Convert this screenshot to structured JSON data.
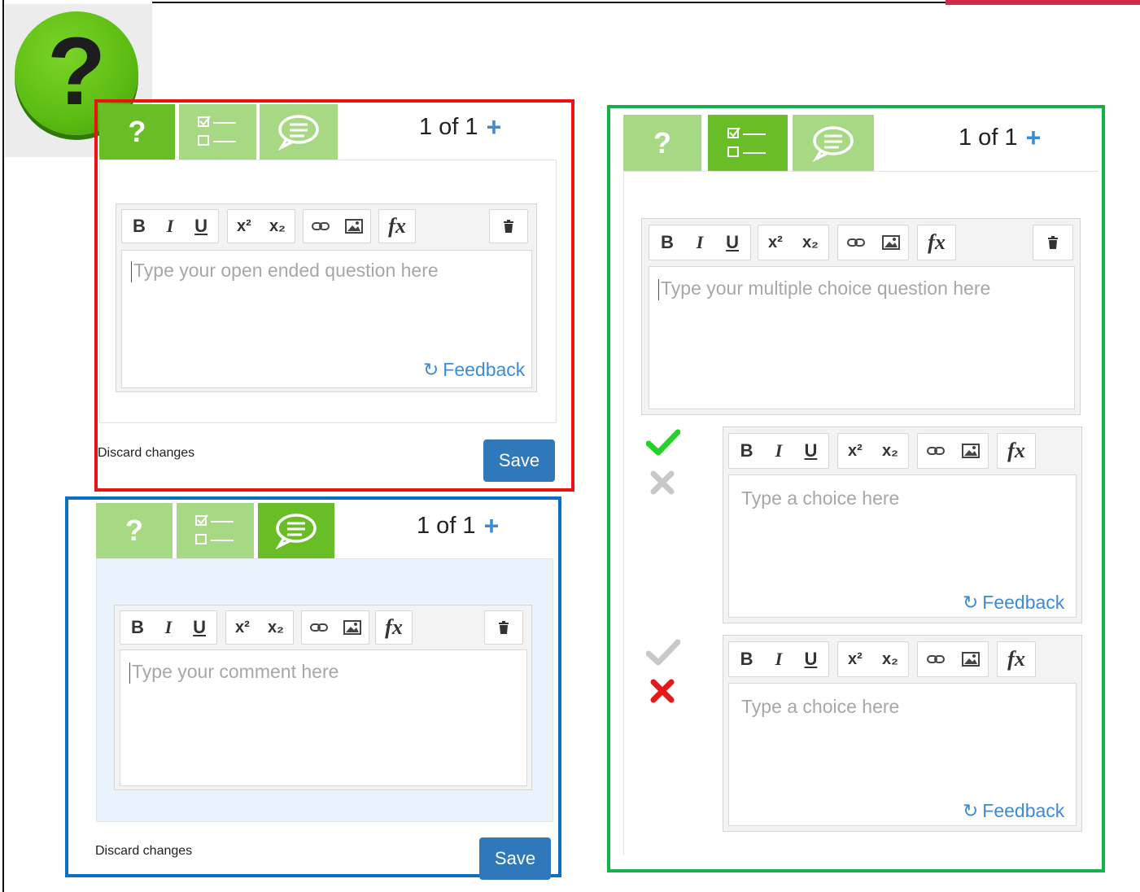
{
  "toolbar": {
    "bold": "B",
    "italic": "I",
    "underline": "U",
    "superscript": "x²",
    "subscript": "x₂",
    "formula": "fx"
  },
  "open_ended": {
    "counter": "1 of 1",
    "add": "+",
    "placeholder": "Type your open ended question here",
    "feedback": "Feedback",
    "discard": "Discard changes",
    "save": "Save"
  },
  "comment": {
    "counter": "1 of 1",
    "add": "+",
    "placeholder": "Type your comment here",
    "discard": "Discard changes",
    "save": "Save"
  },
  "multiple_choice": {
    "counter": "1 of 1",
    "add": "+",
    "placeholder": "Type your multiple choice question here",
    "choices": [
      {
        "placeholder": "Type a choice here",
        "feedback": "Feedback",
        "correct": true
      },
      {
        "placeholder": "Type a choice here",
        "feedback": "Feedback",
        "correct": false
      }
    ]
  },
  "colors": {
    "tab_active": "#69be28",
    "tab_inactive": "#a7d985",
    "save_button": "#2f78b9",
    "feedback_link": "#3d8bd3",
    "outline_open_ended": "#ee1111",
    "outline_comment": "#0c6fc4",
    "outline_multiple_choice": "#13b14a"
  }
}
